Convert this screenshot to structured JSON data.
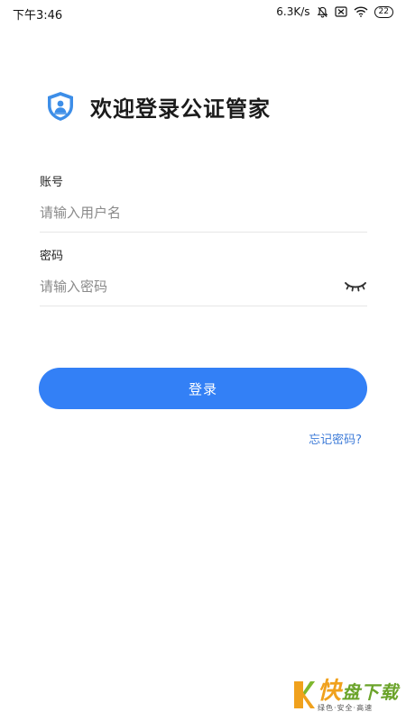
{
  "status_bar": {
    "time": "下午3:46",
    "net_speed": "6.3K/s",
    "battery": "22"
  },
  "header": {
    "title": "欢迎登录公证管家",
    "logo_icon": "shield-user-icon"
  },
  "form": {
    "account_label": "账号",
    "account_placeholder": "请输入用户名",
    "password_label": "密码",
    "password_placeholder": "请输入密码",
    "password_toggle_icon": "eye-closed-icon"
  },
  "actions": {
    "login_label": "登录",
    "forgot_label": "忘记密码?"
  },
  "watermark": {
    "first_char": "快",
    "rest": "盘下载",
    "sub": "绿色·安全·高速"
  },
  "colors": {
    "primary": "#3380f6",
    "link": "#3d7bd8",
    "logo": "#3d8ee8"
  }
}
